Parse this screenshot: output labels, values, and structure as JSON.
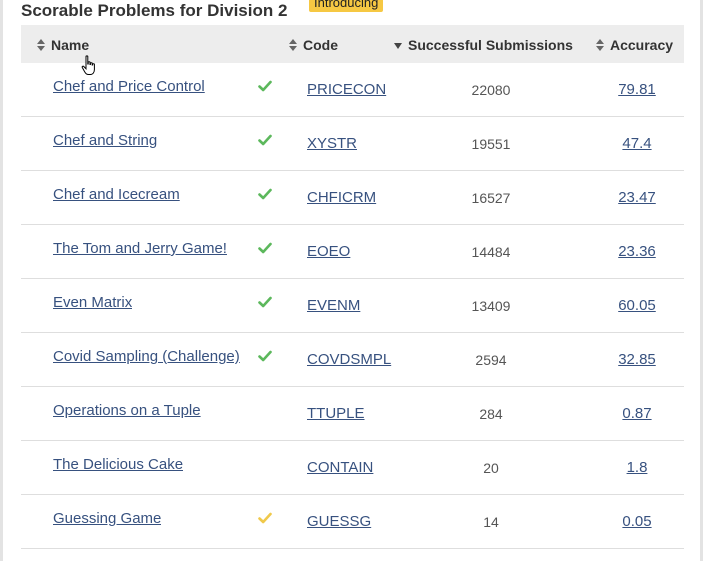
{
  "section": {
    "title": "Scorable Problems for Division 2",
    "badge": "Introducing"
  },
  "table": {
    "columns": [
      {
        "label": "Name",
        "sort": "both"
      },
      {
        "label": "Code",
        "sort": "both"
      },
      {
        "label": "Successful Submissions",
        "sort": "desc"
      },
      {
        "label": "Accuracy",
        "sort": "both"
      }
    ],
    "rows": [
      {
        "name": "Chef and Price Control",
        "status": "solved",
        "code": "PRICECON",
        "submissions": "22080",
        "accuracy": "79.81"
      },
      {
        "name": "Chef and String",
        "status": "solved",
        "code": "XYSTR",
        "submissions": "19551",
        "accuracy": "47.4"
      },
      {
        "name": "Chef and Icecream",
        "status": "solved",
        "code": "CHFICRM",
        "submissions": "16527",
        "accuracy": "23.47"
      },
      {
        "name": "The Tom and Jerry Game!",
        "status": "solved",
        "code": "EOEO",
        "submissions": "14484",
        "accuracy": "23.36"
      },
      {
        "name": "Even Matrix",
        "status": "solved",
        "code": "EVENM",
        "submissions": "13409",
        "accuracy": "60.05"
      },
      {
        "name": "Covid Sampling (Challenge)",
        "status": "solved",
        "code": "COVDSMPL",
        "submissions": "2594",
        "accuracy": "32.85"
      },
      {
        "name": "Operations on a Tuple",
        "status": "none",
        "code": "TTUPLE",
        "submissions": "284",
        "accuracy": "0.87"
      },
      {
        "name": "The Delicious Cake",
        "status": "none",
        "code": "CONTAIN",
        "submissions": "20",
        "accuracy": "1.8"
      },
      {
        "name": "Guessing Game",
        "status": "partial",
        "code": "GUESSG",
        "submissions": "14",
        "accuracy": "0.05"
      }
    ]
  },
  "colors": {
    "link": "#37517f",
    "solved_check": "#5cb85c",
    "partial_check": "#f0c94b",
    "header_bg": "#ededed",
    "badge_bg": "#f6c843"
  },
  "icons": {
    "sort": "sort-updown-icon",
    "sort_desc": "sort-down-icon",
    "check": "check-icon",
    "cursor": "hand-pointer-icon"
  }
}
